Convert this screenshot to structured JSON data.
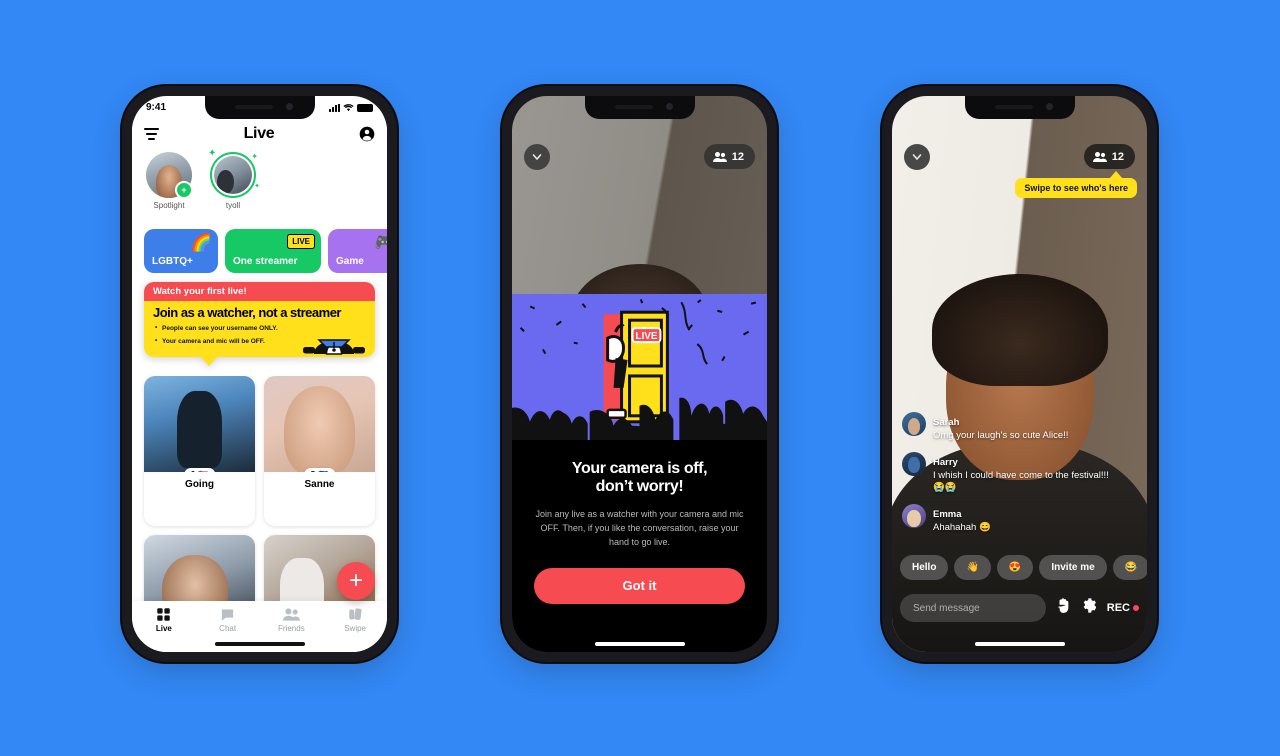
{
  "background_color": "#3388f5",
  "accent_colors": {
    "red": "#f74b52",
    "green": "#17c964",
    "yellow": "#ffe01b",
    "blue": "#3d7ee8",
    "purple": "#a672ef",
    "illustration_bg": "#6a6af0"
  },
  "phone1": {
    "status_bar": {
      "time": "9:41"
    },
    "header": {
      "title": "Live",
      "filter_icon": "filter-icon",
      "profile_icon": "account-circle-icon"
    },
    "stories": [
      {
        "label": "Spotlight",
        "badge": "+",
        "has_ring": false
      },
      {
        "label": "tyoll",
        "badge": "",
        "has_ring": true
      }
    ],
    "chips": [
      {
        "label": "LGBTQ+",
        "emoji": "🌈",
        "color": "#3d7ee8"
      },
      {
        "label": "One streamer",
        "emoji": "LIVE",
        "color": "#17c964"
      },
      {
        "label": "Game",
        "emoji": "🎮",
        "color": "#a672ef"
      }
    ],
    "banner": {
      "kicker": "Watch your first live!",
      "headline": "Join as a watcher, not a streamer",
      "bullets": [
        "People can see your username ONLY.",
        "Your camera and mic will be OFF."
      ]
    },
    "cards": [
      {
        "name": "Going",
        "count": "3",
        "flag": "🇺🇸"
      },
      {
        "name": "Sanne",
        "count": "5",
        "flag": "🇵🇭"
      },
      {
        "name": "",
        "count": "",
        "flag": ""
      },
      {
        "name": "",
        "count": "",
        "flag": ""
      }
    ],
    "fab": {
      "label": "+"
    },
    "tabs": [
      {
        "label": "Live",
        "icon": "grid-icon",
        "active": true
      },
      {
        "label": "Chat",
        "icon": "chat-bubble-icon",
        "active": false
      },
      {
        "label": "Friends",
        "icon": "people-icon",
        "active": false
      },
      {
        "label": "Swipe",
        "icon": "cards-swipe-icon",
        "active": false
      }
    ]
  },
  "phone2": {
    "collapse_icon": "chevron-down-icon",
    "viewers": {
      "icon": "people-icon",
      "count": "12"
    },
    "illustration": {
      "badge": "LIVE",
      "description": "crowd-with-raised-hands-and-door"
    },
    "headline_line1": "Your camera is off,",
    "headline_line2": "don’t worry!",
    "body": "Join any live as a watcher with your camera and mic OFF. Then, if you like the conversation, raise your hand to go live.",
    "primary_button": "Got it"
  },
  "phone3": {
    "collapse_icon": "chevron-down-icon",
    "viewers": {
      "icon": "people-icon",
      "count": "12"
    },
    "tooltip": "Swipe to see who's here",
    "messages": [
      {
        "name": "Sarah",
        "text": "Omg your laugh's so cute Alice!!"
      },
      {
        "name": "Harry",
        "text": "I whish I could have come to the festival!!! 😭😭"
      },
      {
        "name": "Emma",
        "text": "Ahahahah 😄"
      }
    ],
    "quick_replies": [
      {
        "label": "Hello"
      },
      {
        "label": "👋"
      },
      {
        "label": "😍"
      },
      {
        "label": "Invite me"
      },
      {
        "label": "😂"
      }
    ],
    "composer_placeholder": "Send message",
    "actions": [
      {
        "name": "raise-hand-button",
        "label": "✋"
      },
      {
        "name": "settings-button",
        "label": "⚙"
      },
      {
        "name": "record-button",
        "label": "REC"
      }
    ]
  }
}
